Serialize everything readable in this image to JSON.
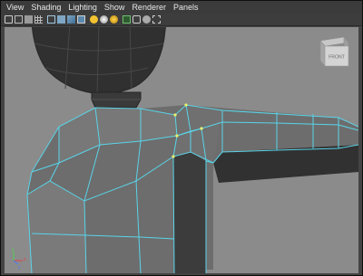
{
  "menubar": {
    "items": [
      {
        "label": "View"
      },
      {
        "label": "Shading"
      },
      {
        "label": "Lighting"
      },
      {
        "label": "Show"
      },
      {
        "label": "Renderer"
      },
      {
        "label": "Panels"
      }
    ]
  },
  "toolbar": {
    "icons": [
      "camera-icon",
      "film-gate-icon",
      "bookmark-icon",
      "grid-icon",
      "wireframe-icon",
      "smooth-shade-icon",
      "textured-icon",
      "flat-shade-icon",
      "lights-icon",
      "default-light-icon",
      "shadow-icon",
      "isolate-icon",
      "xray-icon",
      "xray-joints-icon",
      "component-xray-icon"
    ]
  },
  "viewport": {
    "background_color": "#8b8b8b",
    "wire_color": "#5ad4e8",
    "view_cube_label": "FRONT",
    "axis_labels": {
      "x": "x",
      "y": "y",
      "z": "z"
    }
  }
}
